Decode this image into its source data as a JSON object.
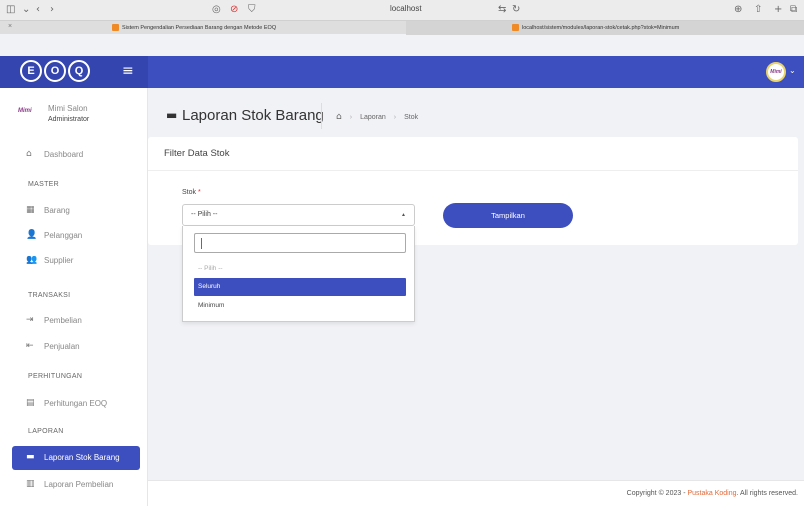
{
  "browser": {
    "address": "localhost",
    "tabs": [
      {
        "title": "Sistem Pengendalian Persediaan Barang dengan Metode EOQ"
      },
      {
        "title": "localhost/sistem/modules/laporan-stok/cetak.php?stok=Minimum"
      }
    ]
  },
  "header": {
    "logo_letters": [
      "E",
      "O",
      "Q"
    ],
    "avatar_text": "Mimi"
  },
  "sidebar": {
    "user_logo": "Mimi",
    "user_name": "Mimi Salon",
    "user_role": "Administrator",
    "dashboard": "Dashboard",
    "section_master": "MASTER",
    "barang": "Barang",
    "pelanggan": "Pelanggan",
    "supplier": "Supplier",
    "section_transaksi": "TRANSAKSI",
    "pembelian": "Pembelian",
    "penjualan": "Penjualan",
    "section_perhitungan": "PERHITUNGAN",
    "perhitungan_eoq": "Perhitungan EOQ",
    "section_laporan": "LAPORAN",
    "laporan_stok": "Laporan Stok Barang",
    "laporan_pembelian": "Laporan Pembelian"
  },
  "main": {
    "page_title": "Laporan Stok Barang",
    "breadcrumb": [
      "Laporan",
      "Stok"
    ],
    "card_title": "Filter Data Stok",
    "stok_label": "Stok",
    "required_mark": "*",
    "select_value": "-- Pilih --",
    "button_label": "Tampilkan",
    "dropdown_options": [
      {
        "label": "-- Pilih --"
      },
      {
        "label": "Seluruh"
      },
      {
        "label": "Minimum"
      }
    ]
  },
  "footer": {
    "prefix": "Copyright © 2023 - ",
    "brand": "Pustaka Koding",
    "suffix": ". All rights reserved."
  },
  "colors": {
    "primary": "#3d4ebf",
    "brand_link": "#e06a3b"
  }
}
